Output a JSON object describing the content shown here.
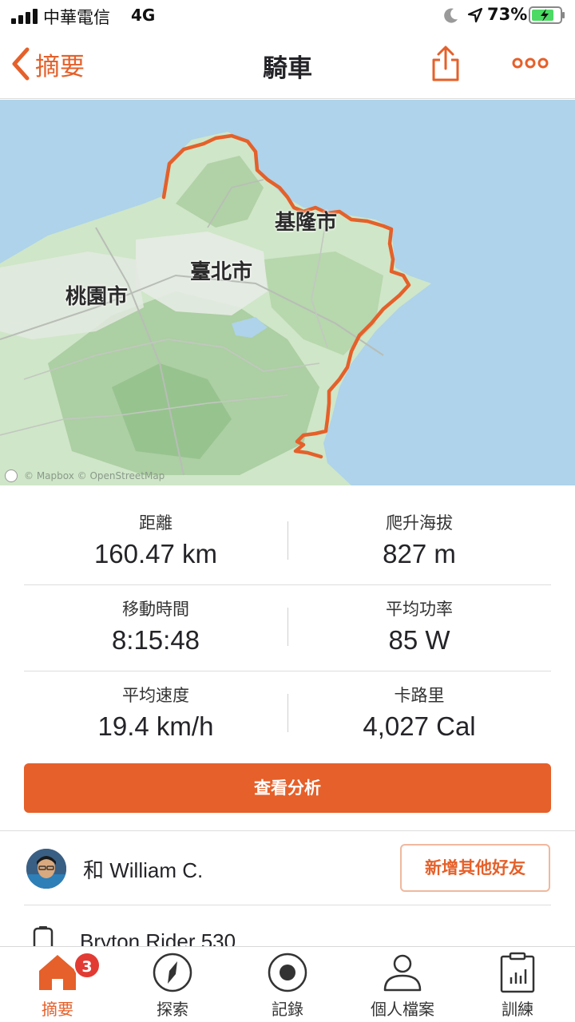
{
  "status_bar": {
    "carrier": "中華電信",
    "network": "4G",
    "battery_percent": "73%"
  },
  "nav": {
    "back_label": "摘要",
    "title": "騎車",
    "icons": [
      "chevron-left-icon",
      "share-icon",
      "more-icon"
    ]
  },
  "map": {
    "labels": {
      "keelung": "基隆市",
      "taipei": "臺北市",
      "taoyuan": "桃園市"
    },
    "attribution": "© Mapbox © OpenStreetMap",
    "route_color": "#e5602a",
    "sea_color": "#aed3ea",
    "land_color": "#cfe6c8"
  },
  "stats": {
    "distance": {
      "label": "距離",
      "value": "160.47 km"
    },
    "elevation": {
      "label": "爬升海拔",
      "value": "827 m"
    },
    "moving_time": {
      "label": "移動時間",
      "value": "8:15:48"
    },
    "avg_power": {
      "label": "平均功率",
      "value": "85 W"
    },
    "avg_speed": {
      "label": "平均速度",
      "value": "19.4 km/h"
    },
    "calories": {
      "label": "卡路里",
      "value": "4,027 Cal"
    }
  },
  "analysis_button": "查看分析",
  "athlete": {
    "name": "和 William C.",
    "add_friends": "新增其他好友"
  },
  "device": {
    "name": "Bryton Rider 530"
  },
  "tabs": [
    {
      "label": "摘要",
      "icon": "home-icon",
      "badge": "3",
      "active": true
    },
    {
      "label": "探索",
      "icon": "compass-icon"
    },
    {
      "label": "記錄",
      "icon": "record-icon"
    },
    {
      "label": "個人檔案",
      "icon": "profile-icon"
    },
    {
      "label": "訓練",
      "icon": "clipboard-icon"
    }
  ],
  "accent_color": "#e5602a"
}
